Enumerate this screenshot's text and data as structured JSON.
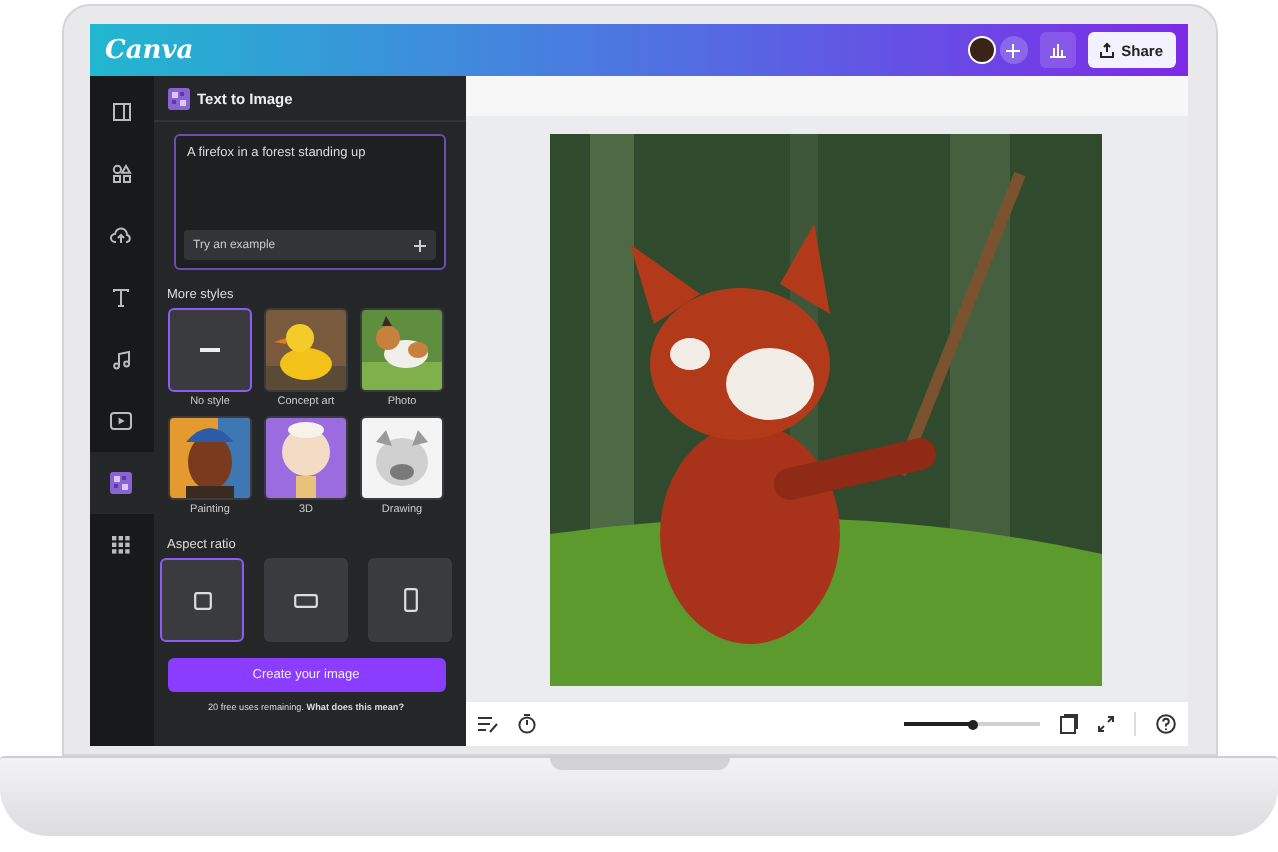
{
  "header": {
    "logo": "Canva",
    "share": "Share"
  },
  "rail": [
    {
      "kind": "design",
      "selected": false
    },
    {
      "kind": "elements",
      "selected": false
    },
    {
      "kind": "uploads",
      "selected": false
    },
    {
      "kind": "text",
      "selected": false
    },
    {
      "kind": "audio",
      "selected": false
    },
    {
      "kind": "video",
      "selected": false
    },
    {
      "kind": "app",
      "selected": true
    },
    {
      "kind": "apps",
      "selected": false
    }
  ],
  "panel": {
    "title": "Text to Image",
    "prompt": "A firefox in a forest standing up",
    "try_example": "Try an example",
    "styles_heading": "More styles",
    "styles": [
      {
        "label": "No style",
        "kind": "none",
        "selected": true
      },
      {
        "label": "Concept art",
        "kind": "duck",
        "selected": false
      },
      {
        "label": "Photo",
        "kind": "dog",
        "selected": false
      },
      {
        "label": "Painting",
        "kind": "portrait",
        "selected": false
      },
      {
        "label": "3D",
        "kind": "toy",
        "selected": false
      },
      {
        "label": "Drawing",
        "kind": "sketch",
        "selected": false
      }
    ],
    "aspect_heading": "Aspect ratio",
    "aspects": [
      {
        "kind": "square",
        "selected": true
      },
      {
        "kind": "landscape",
        "selected": false
      },
      {
        "kind": "portrait",
        "selected": false
      }
    ],
    "create": "Create your image",
    "footnote": "20 free uses remaining.",
    "footnote_link": "What does this mean?"
  },
  "bottom_bar": {
    "zoom": {
      "level": 0.5
    }
  }
}
